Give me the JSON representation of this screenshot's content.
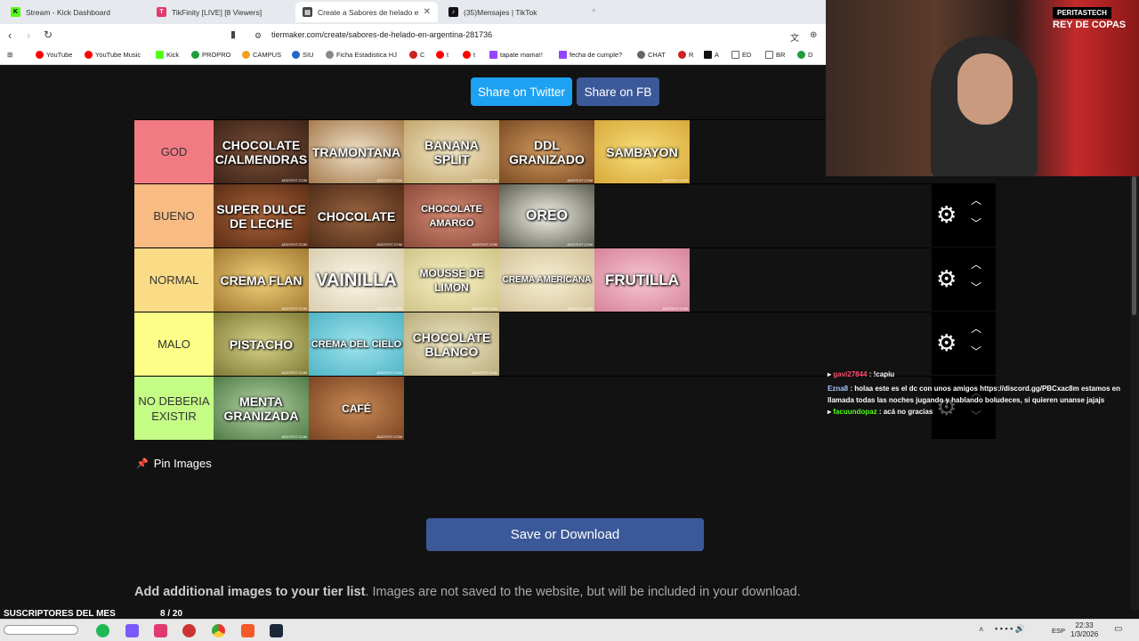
{
  "browser": {
    "tabs": [
      {
        "title": "Stream - Kick Dashboard",
        "color": "#53fc18",
        "glyph": "K"
      },
      {
        "title": "TikFinity [LIVE] [8 Viewers]",
        "color": "#e03b6f",
        "glyph": "T"
      },
      {
        "title": "Create a Sabores de helado en A",
        "color": "#333333",
        "glyph": "▤"
      },
      {
        "title": "(35)Mensajes | TikTok",
        "color": "#111111",
        "glyph": "♪"
      }
    ],
    "url": "tiermaker.com/create/sabores-de-helado-en-argentina-281736",
    "bookmarks": [
      {
        "label": "YouTube",
        "color": "#ff0000"
      },
      {
        "label": "YouTube Music",
        "color": "#ff0000"
      },
      {
        "label": "Kick",
        "color": "#53fc18"
      },
      {
        "label": "PROPRO",
        "color": "#1e9e3e"
      },
      {
        "label": "CAMPUS",
        "color": "#f0a020"
      },
      {
        "label": "SIU",
        "color": "#2266cc"
      },
      {
        "label": "Ficha Estadistica HJ",
        "color": "#888888"
      },
      {
        "label": "C",
        "color": "#cc2222"
      },
      {
        "label": "t",
        "color": "#ff0000"
      },
      {
        "label": "t",
        "color": "#ff0000"
      },
      {
        "label": "tapate mama!!",
        "color": "#9146ff"
      },
      {
        "label": "fecha de cumple?",
        "color": "#9146ff"
      },
      {
        "label": "CHAT",
        "color": "#666666"
      },
      {
        "label": "R",
        "color": "#cc2222"
      },
      {
        "label": "A",
        "color": "#111111"
      },
      {
        "label": "ED",
        "color": "#666666"
      },
      {
        "label": "BR",
        "color": "#666666"
      },
      {
        "label": "D",
        "color": "#1e9e3e"
      }
    ]
  },
  "page": {
    "share_twitter": "Share on Twitter",
    "share_fb": "Share on FB",
    "pin_images": "Pin Images",
    "save_download": "Save or Download",
    "add_images_bold": "Add additional images to your tier list",
    "add_images_rest": ". Images are not saved to the website, but will be included in your download."
  },
  "tiers": [
    {
      "label": "GOD",
      "color": "#f27b83",
      "items": [
        {
          "text": "CHOCOLATE C/ALMENDRAS",
          "bg": "#5a3a2c"
        },
        {
          "text": "TRAMONTANA",
          "bg": "#d8c6a4"
        },
        {
          "text": "BANANA SPLIT",
          "bg": "#e3d3a7"
        },
        {
          "text": "DDL GRANIZADO",
          "bg": "#b57a44"
        },
        {
          "text": "SAMBAYON",
          "bg": "#eecc5a"
        }
      ]
    },
    {
      "label": "BUENO",
      "color": "#f8bb82",
      "items": [
        {
          "text": "SUPER DULCE DE LECHE",
          "bg": "#8a4e2a"
        },
        {
          "text": "CHOCOLATE",
          "bg": "#7a4a2e"
        },
        {
          "text": "CHOCOLATE AMARGO",
          "bg": "#b86a55"
        },
        {
          "text": "OREO",
          "bg": "#cfcfc2"
        }
      ]
    },
    {
      "label": "NORMAL",
      "color": "#fadc87",
      "items": [
        {
          "text": "CREMA FLAN",
          "bg": "#d9b35c"
        },
        {
          "text": "VAINILLA",
          "bg": "#f0ead6"
        },
        {
          "text": "MOUSSE DE LIMON",
          "bg": "#eee6b0"
        },
        {
          "text": "CREMA AMERICANA",
          "bg": "#ede2c0"
        },
        {
          "text": "FRUTILLA",
          "bg": "#eaa7b8"
        }
      ]
    },
    {
      "label": "MALO",
      "color": "#fdfe87",
      "items": [
        {
          "text": "PISTACHO",
          "bg": "#b8b466"
        },
        {
          "text": "CREMA DEL CIELO",
          "bg": "#7cd2de"
        },
        {
          "text": "CHOCOLATE BLANCO",
          "bg": "#dcd3a8"
        }
      ]
    },
    {
      "label": "NO DEBERIA EXISTIR",
      "color": "#c4fc85",
      "items": [
        {
          "text": "MENTA GRANIZADA",
          "bg": "#7ea872"
        },
        {
          "text": "CAFÉ",
          "bg": "#a86a3c"
        }
      ]
    }
  ],
  "watermark": "ADDTEXT.COM",
  "stream": {
    "banner": "PERITASTECH",
    "banner2": "REY DE COPAS",
    "subs_label": "SUSCRIPTORES DEL MES",
    "subs_count": "8 / 20",
    "chat": [
      {
        "user": "gavi27844",
        "user_color": "#ff4d6d",
        "msg": " : !capiu"
      },
      {
        "user": "Ezna8",
        "user_color": "#9ec5ff",
        "msg": " : holaa este es el dc con unos amigos https://discord.gg/PBCxac8m estamos en llamada todas las noches jugando y hablando boludeces, si quieren unanse jajajs"
      },
      {
        "user": "facuundopaz",
        "user_color": "#53fc18",
        "msg": " : acá no gracias"
      }
    ]
  },
  "taskbar": {
    "lang": "ESP",
    "time": "22:33",
    "date": "1/3/2026"
  }
}
